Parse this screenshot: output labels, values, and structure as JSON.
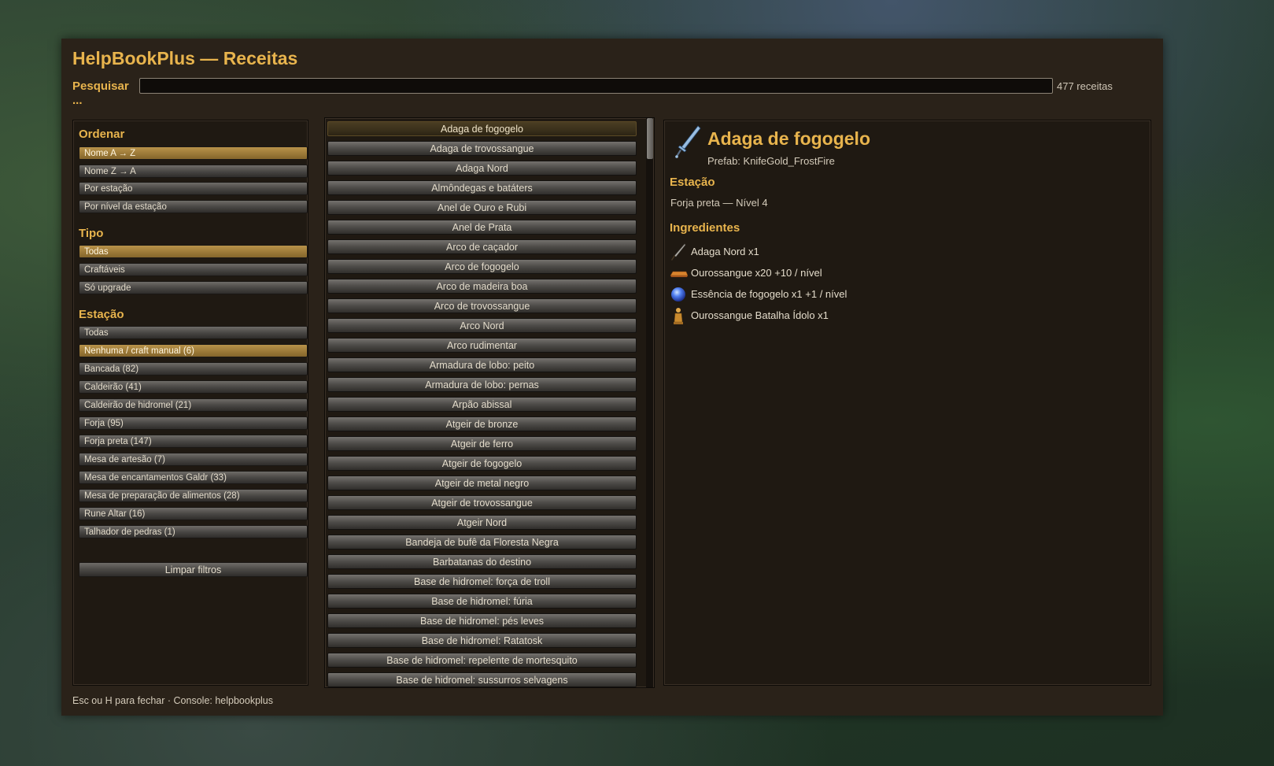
{
  "window": {
    "title": "HelpBookPlus — Receitas",
    "search_label": "Pesquisar ...",
    "search_value": "",
    "recipe_count": "477 receitas"
  },
  "filters": {
    "sort_title": "Ordenar",
    "sort_options": [
      "Nome A → Z",
      "Nome Z → A",
      "Por estação",
      "Por nível da estação"
    ],
    "sort_active": "Nome A → Z",
    "type_title": "Tipo",
    "type_options": [
      "Todas",
      "Craftáveis",
      "Só upgrade"
    ],
    "type_active": "Todas",
    "station_title": "Estação",
    "station_options": [
      "Todas",
      "Nenhuma / craft manual (6)",
      "Bancada (82)",
      "Caldeirão (41)",
      "Caldeirão de hidromel (21)",
      "Forja (95)",
      "Forja preta (147)",
      "Mesa de artesão (7)",
      "Mesa de encantamentos Galdr (33)",
      "Mesa de preparação de alimentos (28)",
      "Rune Altar (16)",
      "Talhador de pedras (1)"
    ],
    "station_active": "Nenhuma / craft manual (6)",
    "clear_label": "Limpar filtros"
  },
  "recipes": {
    "items": [
      "Adaga de fogogelo",
      "Adaga de trovossangue",
      "Adaga Nord",
      "Almôndegas e batáters",
      "Anel de Ouro e Rubi",
      "Anel de Prata",
      "Arco de caçador",
      "Arco de fogogelo",
      "Arco de madeira boa",
      "Arco de trovossangue",
      "Arco Nord",
      "Arco rudimentar",
      "Armadura de lobo: peito",
      "Armadura de lobo: pernas",
      "Arpão abissal",
      "Atgeir de bronze",
      "Atgeir de ferro",
      "Atgeir de fogogelo",
      "Atgeir de metal negro",
      "Atgeir de trovossangue",
      "Atgeir Nord",
      "Bandeja de bufê da Floresta Negra",
      "Barbatanas do destino",
      "Base de hidromel: força de troll",
      "Base de hidromel: fúria",
      "Base de hidromel: pés leves",
      "Base de hidromel: Ratatosk",
      "Base de hidromel: repelente de mortesquito",
      "Base de hidromel: sussurros selvagens"
    ],
    "selected": "Adaga de fogogelo"
  },
  "details": {
    "icon": "dagger-icon",
    "title": "Adaga de fogogelo",
    "prefab": "Prefab: KnifeGold_FrostFire",
    "station_title": "Estação",
    "station_value": "Forja preta — Nível 4",
    "ingredients_title": "Ingredientes",
    "ingredients": [
      {
        "icon": "knife-icon",
        "text": "Adaga Nord  x1"
      },
      {
        "icon": "ingot-icon",
        "text": "Ourossangue  x20  +10 / nível"
      },
      {
        "icon": "orb-icon",
        "text": "Essência de fogogelo  x1  +1 / nível"
      },
      {
        "icon": "idol-icon",
        "text": "Ourossangue Batalha Ídolo  x1"
      }
    ]
  },
  "footer": {
    "hint": "Esc ou H para fechar · Console: helpbookplus"
  },
  "colors": {
    "accent": "#e8b44d",
    "active_button": "#9c7a38",
    "panel_bg": "#1f1912",
    "window_bg": "#2a2219"
  }
}
